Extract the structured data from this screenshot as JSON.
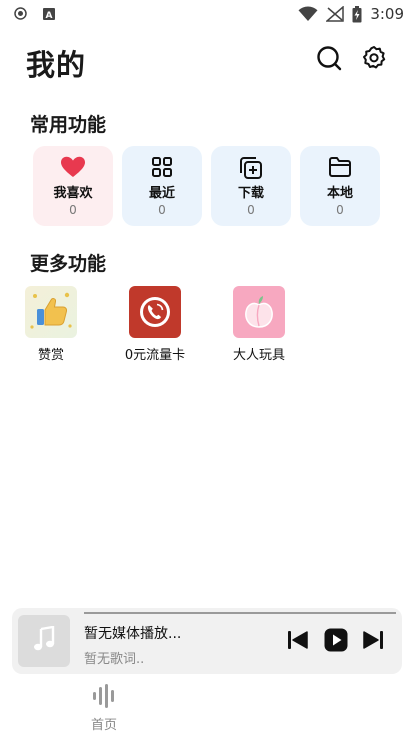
{
  "status_bar": {
    "time": "3:09",
    "left_icons": [
      "record-icon",
      "a-badge-icon"
    ],
    "right_icons": [
      "wifi-icon",
      "no-signal-icon",
      "battery-charging-icon"
    ]
  },
  "header": {
    "title": "我的",
    "icons": [
      "search-icon",
      "settings-icon"
    ]
  },
  "common_section": {
    "title": "常用功能",
    "cards": [
      {
        "label": "我喜欢",
        "count": "0",
        "icon": "heart-icon",
        "color": "#e8394f"
      },
      {
        "label": "最近",
        "count": "0",
        "icon": "grid-icon"
      },
      {
        "label": "下载",
        "count": "0",
        "icon": "download-plus-icon"
      },
      {
        "label": "本地",
        "count": "0",
        "icon": "folder-icon"
      }
    ]
  },
  "more_section": {
    "title": "更多功能",
    "items": [
      {
        "label": "赞赏",
        "icon": "thumbs-up-icon"
      },
      {
        "label": "0元流量卡",
        "icon": "phone-call-icon",
        "color": "#c0392b"
      },
      {
        "label": "大人玩具",
        "icon": "peach-icon",
        "color": "#f7a8c0"
      }
    ]
  },
  "player": {
    "title": "暂无媒体播放...",
    "lyric": "暂无歌词..",
    "controls": [
      "previous-icon",
      "play-icon",
      "next-icon"
    ]
  },
  "bottom_nav": {
    "items": [
      {
        "label": "首页",
        "icon": "soundwave-icon",
        "active": false
      }
    ]
  }
}
